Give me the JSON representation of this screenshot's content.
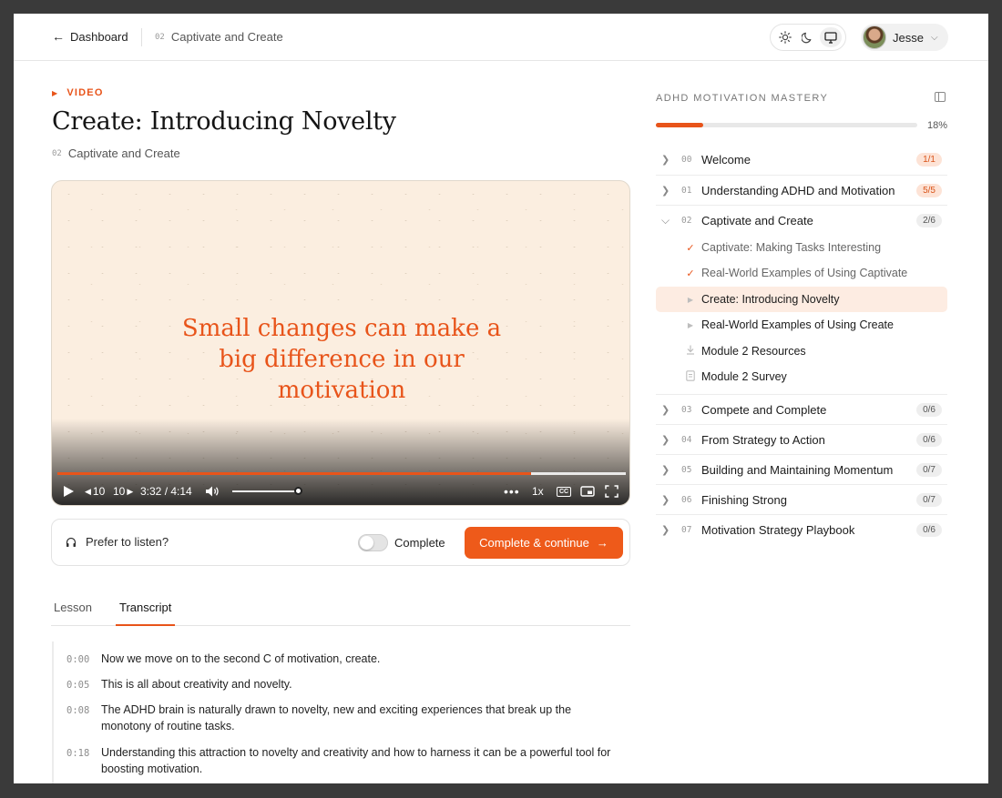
{
  "header": {
    "back_label": "Dashboard",
    "crumb_num": "02",
    "crumb_label": "Captivate and Create",
    "user_name": "Jesse"
  },
  "lesson": {
    "type_label": "VIDEO",
    "title": "Create: Introducing Novelty",
    "module_num": "02",
    "module_name": "Captivate and Create"
  },
  "video": {
    "quote": "Small changes can make a big difference in our motivation",
    "rewind_label": "10",
    "forward_label": "10",
    "time": "3:32 / 4:14",
    "speed": "1x",
    "played_fraction": 0.833,
    "volume_fraction": 0.95,
    "cc_label": "CC"
  },
  "actions": {
    "listen_label": "Prefer to listen?",
    "complete_toggle_label": "Complete",
    "cta_label": "Complete & continue"
  },
  "tabs": [
    {
      "label": "Lesson",
      "active": false
    },
    {
      "label": "Transcript",
      "active": true
    }
  ],
  "transcript": [
    {
      "time": "0:00",
      "text": "Now we move on to the second C of motivation, create."
    },
    {
      "time": "0:05",
      "text": "This is all about creativity and novelty."
    },
    {
      "time": "0:08",
      "text": "The ADHD brain is naturally drawn to novelty, new and exciting experiences that break up the monotony of routine tasks."
    },
    {
      "time": "0:18",
      "text": "Understanding this attraction to novelty and creativity and how to harness it can be a powerful tool for boosting motivation."
    }
  ],
  "course": {
    "title": "ADHD MOTIVATION MASTERY",
    "progress_label": "18%",
    "progress_fraction": 0.18,
    "modules": [
      {
        "num": "00",
        "title": "Welcome",
        "badge": "1/1",
        "badge_style": "orange",
        "expanded": false
      },
      {
        "num": "01",
        "title": "Understanding ADHD and Motivation",
        "badge": "5/5",
        "badge_style": "orange",
        "expanded": false
      },
      {
        "num": "02",
        "title": "Captivate and Create",
        "badge": "2/6",
        "badge_style": "gray",
        "expanded": true
      },
      {
        "num": "03",
        "title": "Compete and Complete",
        "badge": "0/6",
        "badge_style": "gray",
        "expanded": false
      },
      {
        "num": "04",
        "title": "From Strategy to Action",
        "badge": "0/6",
        "badge_style": "gray",
        "expanded": false
      },
      {
        "num": "05",
        "title": "Building and Maintaining Momentum",
        "badge": "0/7",
        "badge_style": "gray",
        "expanded": false
      },
      {
        "num": "06",
        "title": "Finishing Strong",
        "badge": "0/7",
        "badge_style": "gray",
        "expanded": false
      },
      {
        "num": "07",
        "title": "Motivation Strategy Playbook",
        "badge": "0/6",
        "badge_style": "gray",
        "expanded": false
      }
    ],
    "lessons": [
      {
        "title": "Captivate: Making Tasks Interesting",
        "icon": "check-icon",
        "state": "done"
      },
      {
        "title": "Real-World Examples of Using Captivate",
        "icon": "check-icon",
        "state": "done"
      },
      {
        "title": "Create: Introducing Novelty",
        "icon": "play-icon",
        "state": "active"
      },
      {
        "title": "Real-World Examples of Using Create",
        "icon": "play-icon",
        "state": "pending"
      },
      {
        "title": "Module 2 Resources",
        "icon": "download-icon",
        "state": "pending"
      },
      {
        "title": "Module 2 Survey",
        "icon": "survey-icon",
        "state": "pending"
      }
    ]
  },
  "colors": {
    "accent": "#e8541a",
    "accent_light": "#fdece2",
    "video_bg": "#fbeee0"
  }
}
